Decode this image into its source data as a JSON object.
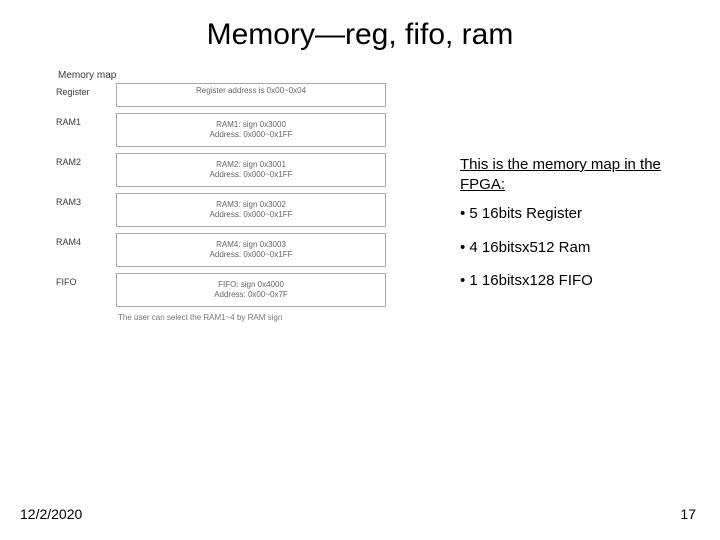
{
  "title": "Memory—reg, fifo, ram",
  "diagram": {
    "header": "Memory map",
    "rows": [
      {
        "label": "Register",
        "line1": "Register address is 0x00~0x04",
        "line2": ""
      },
      {
        "label": "RAM1",
        "line1": "RAM1: sign 0x3000",
        "line2": "Address: 0x000~0x1FF"
      },
      {
        "label": "RAM2",
        "line1": "RAM2: sign 0x3001",
        "line2": "Address: 0x000~0x1FF"
      },
      {
        "label": "RAM3",
        "line1": "RAM3: sign 0x3002",
        "line2": "Address: 0x000~0x1FF"
      },
      {
        "label": "RAM4",
        "line1": "RAM4: sign 0x3003",
        "line2": "Address: 0x000~0x1FF"
      },
      {
        "label": "FIFO",
        "line1": "FIFO: sign 0x4000",
        "line2": "Address: 0x00~0x7F"
      }
    ],
    "footnote": "The user can select the RAM1~4 by RAM sign"
  },
  "bullets": {
    "intro": "This is the memory map in the FPGA:",
    "items": [
      "• 5 16bits Register",
      "• 4 16bitsx512 Ram",
      "• 1 16bitsx128 FIFO"
    ]
  },
  "footer": {
    "date": "12/2/2020",
    "page": "17"
  }
}
